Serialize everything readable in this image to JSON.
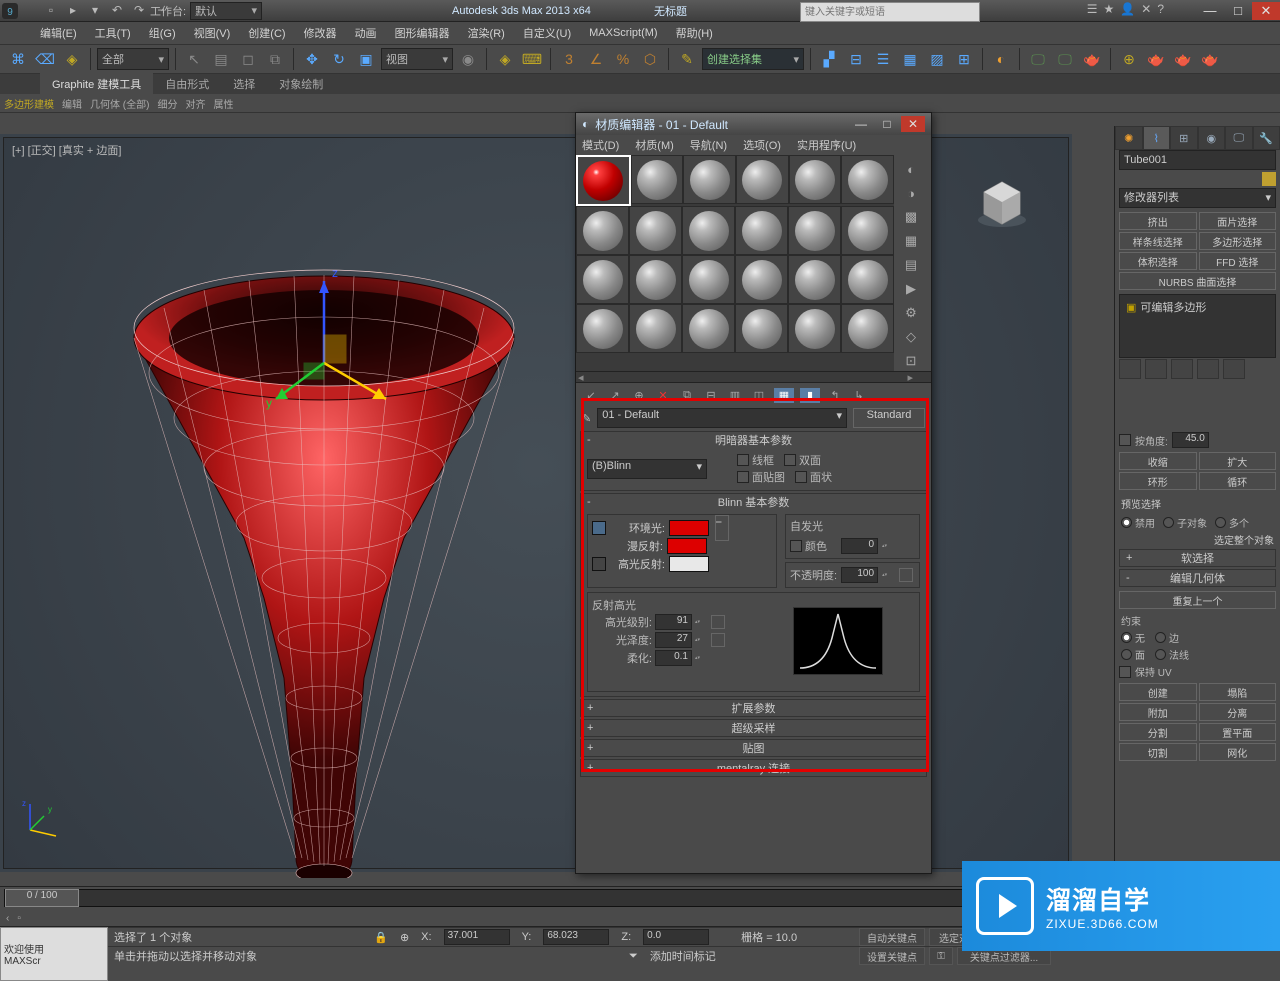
{
  "app": {
    "title_prefix": "Autodesk 3ds Max  2013 x64",
    "doc": "无标题",
    "search_placeholder": "键入关键字或短语",
    "workspace_label": "工作台:",
    "workspace_value": "默认"
  },
  "menubar": [
    "编辑(E)",
    "工具(T)",
    "组(G)",
    "视图(V)",
    "创建(C)",
    "修改器",
    "动画",
    "图形编辑器",
    "渲染(R)",
    "自定义(U)",
    "MAXScript(M)",
    "帮助(H)"
  ],
  "toolbar": {
    "scope_sel": "全部",
    "coord_sel": "视图",
    "named_sel": "创建选择集"
  },
  "ribbon": {
    "tabs": [
      "Graphite 建模工具",
      "自由形式",
      "选择",
      "对象绘制"
    ],
    "sub": [
      "多边形建模",
      "编辑",
      "几何体 (全部)",
      "细分",
      "对齐",
      "属性"
    ]
  },
  "viewport": {
    "label": "[+] [正交] [真实 + 边面]"
  },
  "material_editor": {
    "title": "材质编辑器 - 01 - Default",
    "menus": [
      "模式(D)",
      "材质(M)",
      "导航(N)",
      "选项(O)",
      "实用程序(U)"
    ],
    "name": "01 - Default",
    "type_btn": "Standard",
    "rollouts": {
      "shader": {
        "title": "明暗器基本参数",
        "sel": "(B)Blinn",
        "wire": "线框",
        "two": "双面",
        "facemap": "面贴图",
        "facet": "面状"
      },
      "blinn": {
        "title": "Blinn 基本参数",
        "ambient": "环境光:",
        "diffuse": "漫反射:",
        "specular": "高光反射:",
        "self_illum": "自发光",
        "self_color": "颜色",
        "self_val": "0",
        "opacity": "不透明度:",
        "opacity_val": "100",
        "spec_group": "反射高光",
        "spec_level": "高光级别:",
        "spec_level_val": "91",
        "gloss": "光泽度:",
        "gloss_val": "27",
        "soften": "柔化:",
        "soften_val": "0.1"
      },
      "extended": "扩展参数",
      "supersample": "超级采样",
      "maps": "贴图",
      "mentalray": "mentalray 连接"
    }
  },
  "cmd_panel": {
    "object_name": "Tube001",
    "mod_label": "修改器列表",
    "preset_btns": [
      "挤出",
      "面片选择",
      "样条线选择",
      "多边形选择",
      "体积选择",
      "FFD 选择"
    ],
    "preset_full": "NURBS 曲面选择",
    "mod_stack": "可编辑多边形",
    "angle_lbl": "按角度:",
    "angle_val": "45.0",
    "shrink": "收缩",
    "grow": "扩大",
    "ring": "环形",
    "loop": "循环",
    "preview": "预览选择",
    "disable": "禁用",
    "subobj": "子对象",
    "multi": "多个",
    "select_whole": "选定整个对象",
    "soft_sel": "软选择",
    "edit_geom": "编辑几何体",
    "repeat": "重复上一个",
    "constraint": "约束",
    "none": "无",
    "edge": "边",
    "face": "面",
    "normal": "法线",
    "preserve_uv": "保持 UV",
    "create": "创建",
    "collapse": "塌陷",
    "attach": "附加",
    "detach": "分离",
    "split": "分割",
    "flat": "置平面",
    "cut": "切割",
    "msmooth": "网化"
  },
  "timeline": {
    "range": "0 / 100"
  },
  "status": {
    "welcome_l1": "欢迎使用",
    "welcome_l2": "MAXScr",
    "sel_line": "选择了 1 个对象",
    "hint": "单击并拖动以选择并移动对象",
    "x": "37.001",
    "y": "68.023",
    "z": "0.0",
    "grid": "栅格 = 10.0",
    "add_time_tag": "添加时间标记",
    "autokey": "自动关键点",
    "setkey": "设置关键点",
    "keydrop": "选定对",
    "keyfilter": "关键点过滤器..."
  },
  "watermark": {
    "big": "溜溜自学",
    "site": "ZIXUE.3D66.COM"
  }
}
